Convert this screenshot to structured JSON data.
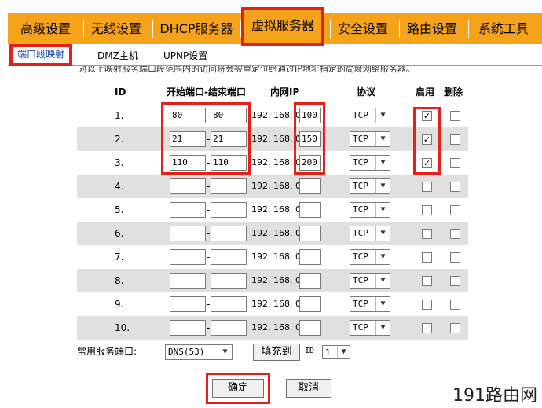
{
  "topnav": {
    "items": [
      "高级设置",
      "无线设置",
      "DHCP服务器",
      "虚拟服务器",
      "安全设置",
      "路由设置",
      "系统工具"
    ],
    "active_index": 3
  },
  "subnav": {
    "items": [
      "端口段映射",
      "DMZ主机",
      "UPNP设置"
    ],
    "active_index": 0
  },
  "notice": "对以上映射服务端口段范围内的访问将会被重定位给通过IP地址指定的局域网络服务器。",
  "table": {
    "headers": {
      "id": "ID",
      "ports": "开始端口-结束端口",
      "ip": "内网IP",
      "protocol": "协议",
      "enable": "启用",
      "delete": "删除"
    },
    "ip_prefix": "192. 168. 0.",
    "rows": [
      {
        "id": "1.",
        "start": "80",
        "end": "80",
        "ip": "100",
        "protocol": "TCP",
        "enabled": true,
        "delete": false
      },
      {
        "id": "2.",
        "start": "21",
        "end": "21",
        "ip": "150",
        "protocol": "TCP",
        "enabled": true,
        "delete": false
      },
      {
        "id": "3.",
        "start": "110",
        "end": "110",
        "ip": "200",
        "protocol": "TCP",
        "enabled": true,
        "delete": false
      },
      {
        "id": "4.",
        "start": "",
        "end": "",
        "ip": "",
        "protocol": "TCP",
        "enabled": false,
        "delete": false
      },
      {
        "id": "5.",
        "start": "",
        "end": "",
        "ip": "",
        "protocol": "TCP",
        "enabled": false,
        "delete": false
      },
      {
        "id": "6.",
        "start": "",
        "end": "",
        "ip": "",
        "protocol": "TCP",
        "enabled": false,
        "delete": false
      },
      {
        "id": "7.",
        "start": "",
        "end": "",
        "ip": "",
        "protocol": "TCP",
        "enabled": false,
        "delete": false
      },
      {
        "id": "8.",
        "start": "",
        "end": "",
        "ip": "",
        "protocol": "TCP",
        "enabled": false,
        "delete": false
      },
      {
        "id": "9.",
        "start": "",
        "end": "",
        "ip": "",
        "protocol": "TCP",
        "enabled": false,
        "delete": false
      },
      {
        "id": "10.",
        "start": "",
        "end": "",
        "ip": "",
        "protocol": "TCP",
        "enabled": false,
        "delete": false
      }
    ]
  },
  "common_ports": {
    "label": "常用服务端口:",
    "selected": "DNS(53)",
    "fill_button": "填充到",
    "id_label": "ID",
    "id_selected": "1"
  },
  "buttons": {
    "ok": "确定",
    "cancel": "取消"
  },
  "watermark": "191路由网",
  "colors": {
    "nav_bg": "#f5a31a",
    "highlight": "#e4201b",
    "row_alt": "#e0e0e0"
  }
}
